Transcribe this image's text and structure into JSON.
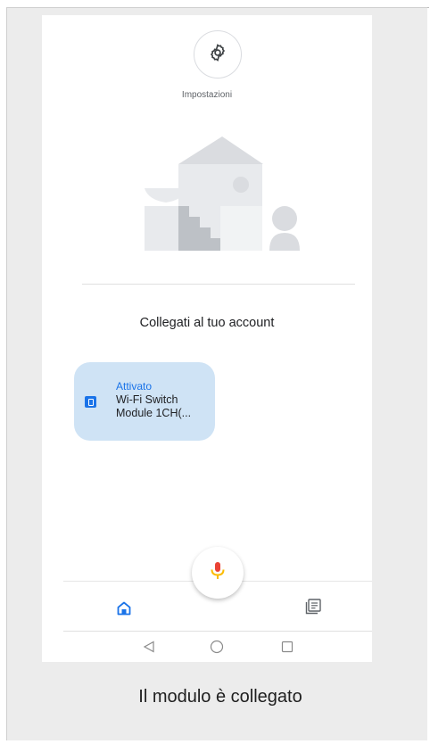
{
  "settings": {
    "label": "Impostazioni",
    "icon": "gear-icon"
  },
  "section": {
    "title": "Collegati al tuo account"
  },
  "device": {
    "status": "Attivato",
    "name": "Wi-Fi Switch Module 1CH(...",
    "icon": "switch-icon"
  },
  "assistant": {
    "icon": "mic-icon"
  },
  "bottom_tabs": [
    {
      "name": "home",
      "icon": "home-icon",
      "active": true
    },
    {
      "name": "feed",
      "icon": "feed-icon",
      "active": false
    }
  ],
  "system_nav": [
    "back-icon",
    "home-circle-icon",
    "recents-icon"
  ],
  "caption": "Il modulo è collegato",
  "colors": {
    "accent": "#1a73e8",
    "card_bg": "#cfe3f5",
    "frame_bg": "#ececec",
    "mic_red": "#ea4335",
    "mic_yellow": "#fbbc04"
  }
}
